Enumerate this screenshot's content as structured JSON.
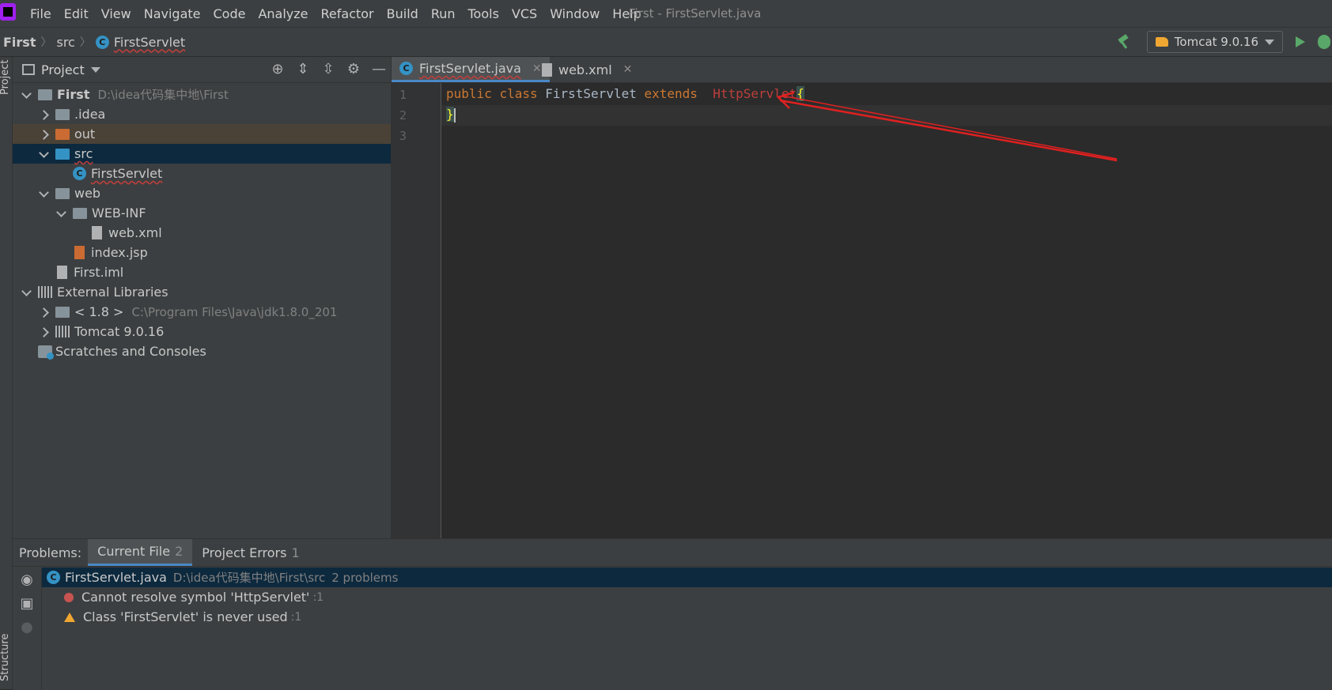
{
  "menubar": {
    "items": [
      "File",
      "Edit",
      "View",
      "Navigate",
      "Code",
      "Analyze",
      "Refactor",
      "Build",
      "Run",
      "Tools",
      "VCS",
      "Window",
      "Help"
    ],
    "window_title": "First - FirstServlet.java"
  },
  "navbar": {
    "crumbs": [
      "First",
      "src",
      "FirstServlet"
    ],
    "run_config": "Tomcat 9.0.16"
  },
  "left_stripe": {
    "project_label": "Project",
    "structure_label": "Structure"
  },
  "project_panel": {
    "title": "Project",
    "tree": [
      {
        "label": "First",
        "extra": "D:\\idea代码集中地\\First"
      },
      {
        "label": ".idea"
      },
      {
        "label": "out"
      },
      {
        "label": "src"
      },
      {
        "label": "FirstServlet"
      },
      {
        "label": "web"
      },
      {
        "label": "WEB-INF"
      },
      {
        "label": "web.xml"
      },
      {
        "label": "index.jsp"
      },
      {
        "label": "First.iml"
      },
      {
        "label": "External Libraries"
      },
      {
        "label": "< 1.8 >",
        "extra": "C:\\Program Files\\Java\\jdk1.8.0_201"
      },
      {
        "label": "Tomcat 9.0.16"
      },
      {
        "label": "Scratches and Consoles"
      }
    ]
  },
  "editor": {
    "tabs": [
      {
        "label": "FirstServlet.java"
      },
      {
        "label": "web.xml"
      }
    ],
    "line_numbers": [
      "1",
      "2",
      "3"
    ],
    "code": {
      "kw_public": "public",
      "kw_class": "class",
      "class_name": "FirstServlet",
      "kw_extends": "extends",
      "parent": "HttpServlet",
      "open_brace": "{",
      "close_brace": "}"
    }
  },
  "problems": {
    "label": "Problems:",
    "tabs": [
      {
        "label": "Current File",
        "count": "2"
      },
      {
        "label": "Project Errors",
        "count": "1"
      }
    ],
    "file": {
      "name": "FirstServlet.java",
      "path": "D:\\idea代码集中地\\First\\src",
      "summary": "2 problems"
    },
    "items": [
      {
        "severity": "error",
        "text": "Cannot resolve symbol 'HttpServlet'",
        "loc": ":1"
      },
      {
        "severity": "warning",
        "text": "Class 'FirstServlet' is never used",
        "loc": ":1"
      }
    ]
  },
  "colors": {
    "accent": "#4a88c7",
    "error": "#bc3f3c",
    "warning": "#f0a732",
    "keyword": "#cc7832"
  }
}
